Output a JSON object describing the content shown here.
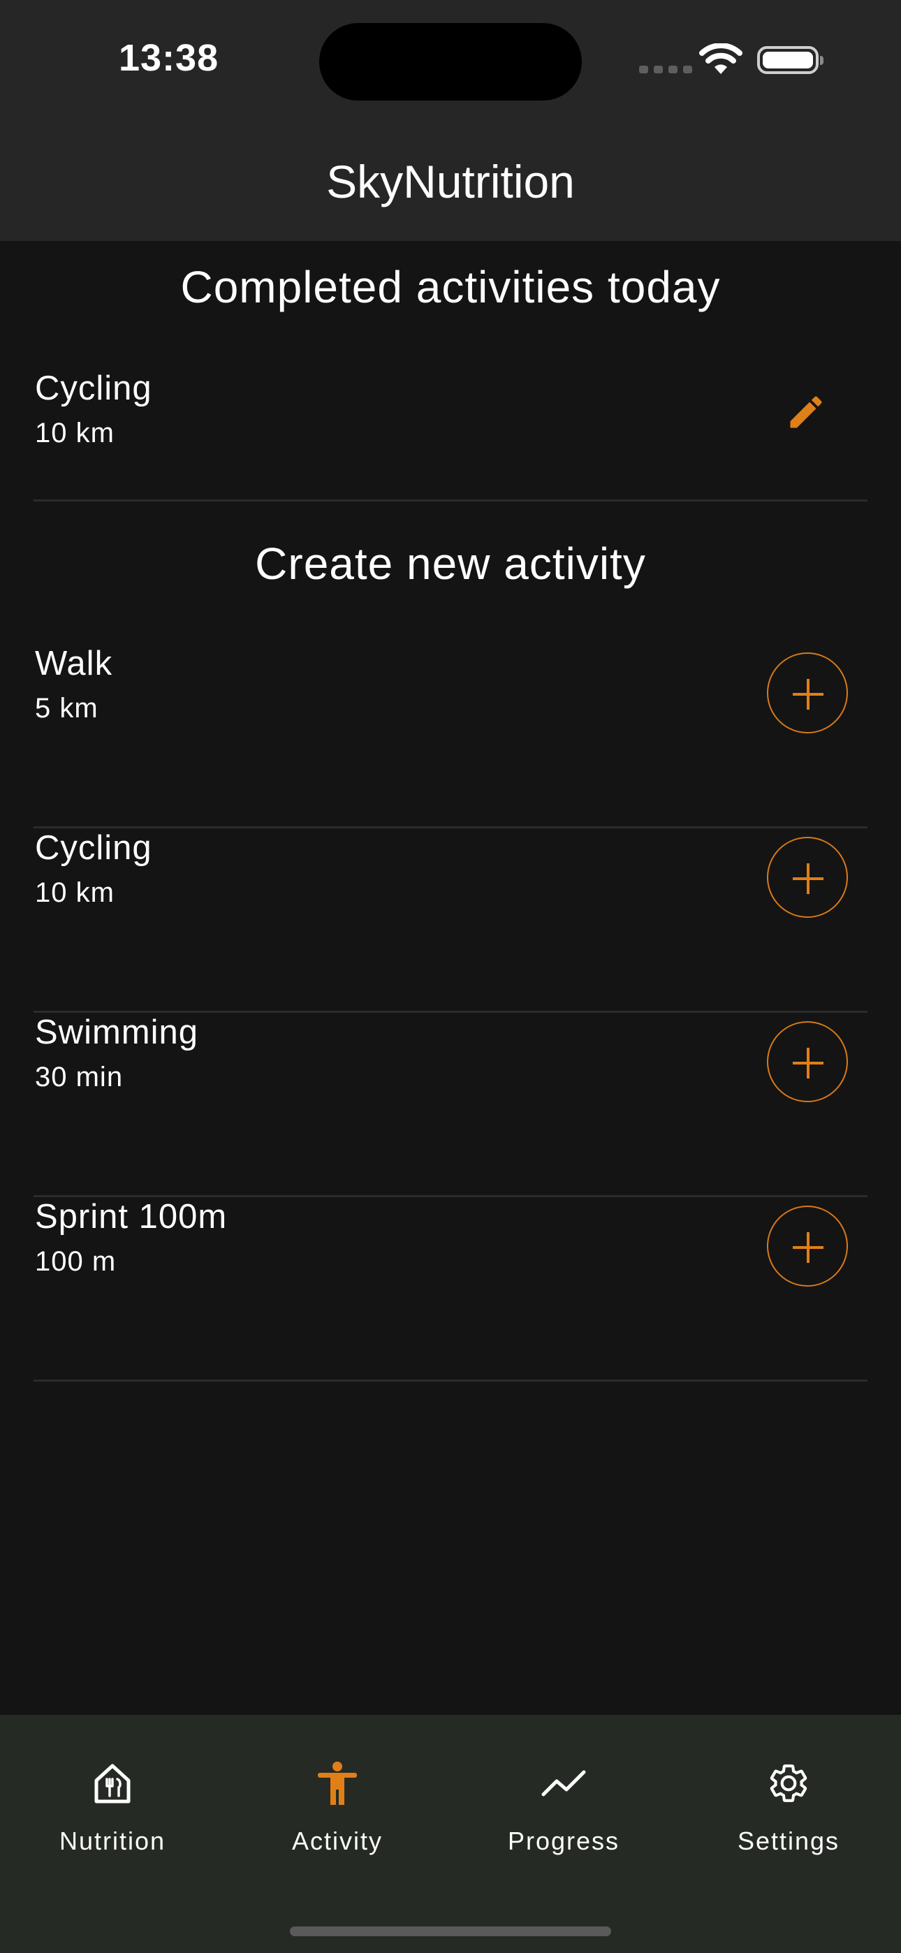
{
  "status_bar": {
    "time": "13:38"
  },
  "header": {
    "title": "SkyNutrition"
  },
  "completed": {
    "title": "Completed activities today",
    "items": [
      {
        "name": "Cycling",
        "amount": "10 km"
      }
    ]
  },
  "create": {
    "title": "Create new activity",
    "items": [
      {
        "name": "Walk",
        "amount": "5 km"
      },
      {
        "name": "Cycling",
        "amount": "10 km"
      },
      {
        "name": "Swimming",
        "amount": "30 min"
      },
      {
        "name": "Sprint 100m",
        "amount": "100 m"
      }
    ]
  },
  "nav": {
    "items": [
      {
        "label": "Nutrition",
        "icon": "nutrition-icon",
        "active": false
      },
      {
        "label": "Activity",
        "icon": "person-icon",
        "active": true
      },
      {
        "label": "Progress",
        "icon": "trend-line-icon",
        "active": false
      },
      {
        "label": "Settings",
        "icon": "gear-icon",
        "active": false
      }
    ]
  },
  "colors": {
    "accent": "#E07F18",
    "background": "#141414",
    "header": "#262626",
    "nav_background": "#262A24"
  }
}
